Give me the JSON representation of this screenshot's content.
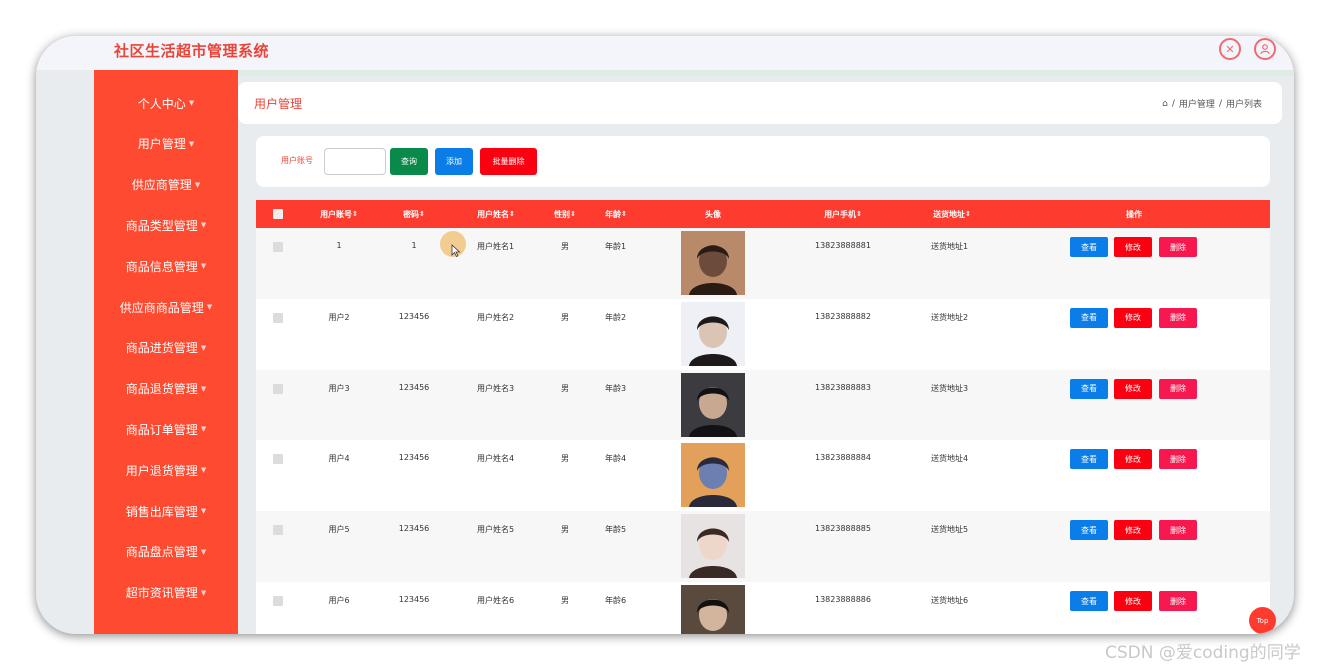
{
  "app": {
    "title": "社区生活超市管理系统"
  },
  "topbar": {
    "icons": [
      "expand-icon",
      "user-icon"
    ]
  },
  "sidebar": {
    "items": [
      {
        "label": "个人中心"
      },
      {
        "label": "用户管理"
      },
      {
        "label": "供应商管理"
      },
      {
        "label": "商品类型管理"
      },
      {
        "label": "商品信息管理"
      },
      {
        "label": "供应商商品管理"
      },
      {
        "label": "商品进货管理"
      },
      {
        "label": "商品退货管理"
      },
      {
        "label": "商品订单管理"
      },
      {
        "label": "用户退货管理"
      },
      {
        "label": "销售出库管理"
      },
      {
        "label": "商品盘点管理"
      },
      {
        "label": "超市资讯管理"
      }
    ]
  },
  "header": {
    "title": "用户管理",
    "breadcrumb": [
      "用户管理",
      "用户列表"
    ]
  },
  "search": {
    "label": "用户账号",
    "value": "",
    "query_label": "查询",
    "add_label": "添加",
    "batch_delete_label": "批量删除"
  },
  "table": {
    "columns": [
      "用户账号",
      "密码",
      "用户姓名",
      "性别",
      "年龄",
      "头像",
      "用户手机",
      "送货地址",
      "操作"
    ],
    "rows": [
      {
        "account": "1",
        "password": "1",
        "name": "用户姓名1",
        "gender": "男",
        "age": "年龄1",
        "phone": "13823888881",
        "address": "送货地址1"
      },
      {
        "account": "用户2",
        "password": "123456",
        "name": "用户姓名2",
        "gender": "男",
        "age": "年龄2",
        "phone": "13823888882",
        "address": "送货地址2"
      },
      {
        "account": "用户3",
        "password": "123456",
        "name": "用户姓名3",
        "gender": "男",
        "age": "年龄3",
        "phone": "13823888883",
        "address": "送货地址3"
      },
      {
        "account": "用户4",
        "password": "123456",
        "name": "用户姓名4",
        "gender": "男",
        "age": "年龄4",
        "phone": "13823888884",
        "address": "送货地址4"
      },
      {
        "account": "用户5",
        "password": "123456",
        "name": "用户姓名5",
        "gender": "男",
        "age": "年龄5",
        "phone": "13823888885",
        "address": "送货地址5"
      },
      {
        "account": "用户6",
        "password": "123456",
        "name": "用户姓名6",
        "gender": "男",
        "age": "年龄6",
        "phone": "13823888886",
        "address": "送货地址6"
      }
    ],
    "actions": {
      "view": "查看",
      "edit": "修改",
      "delete": "删除"
    }
  },
  "top_button": "Top",
  "watermark": "CSDN @爱coding的同学",
  "colors": {
    "accent": "#fe3b2f",
    "sidebar": "#fe4a30",
    "view_button": "#0a7de8",
    "edit_button": "#fa0010",
    "delete_button": "#f7184f",
    "query_button": "#0a8a4a"
  }
}
